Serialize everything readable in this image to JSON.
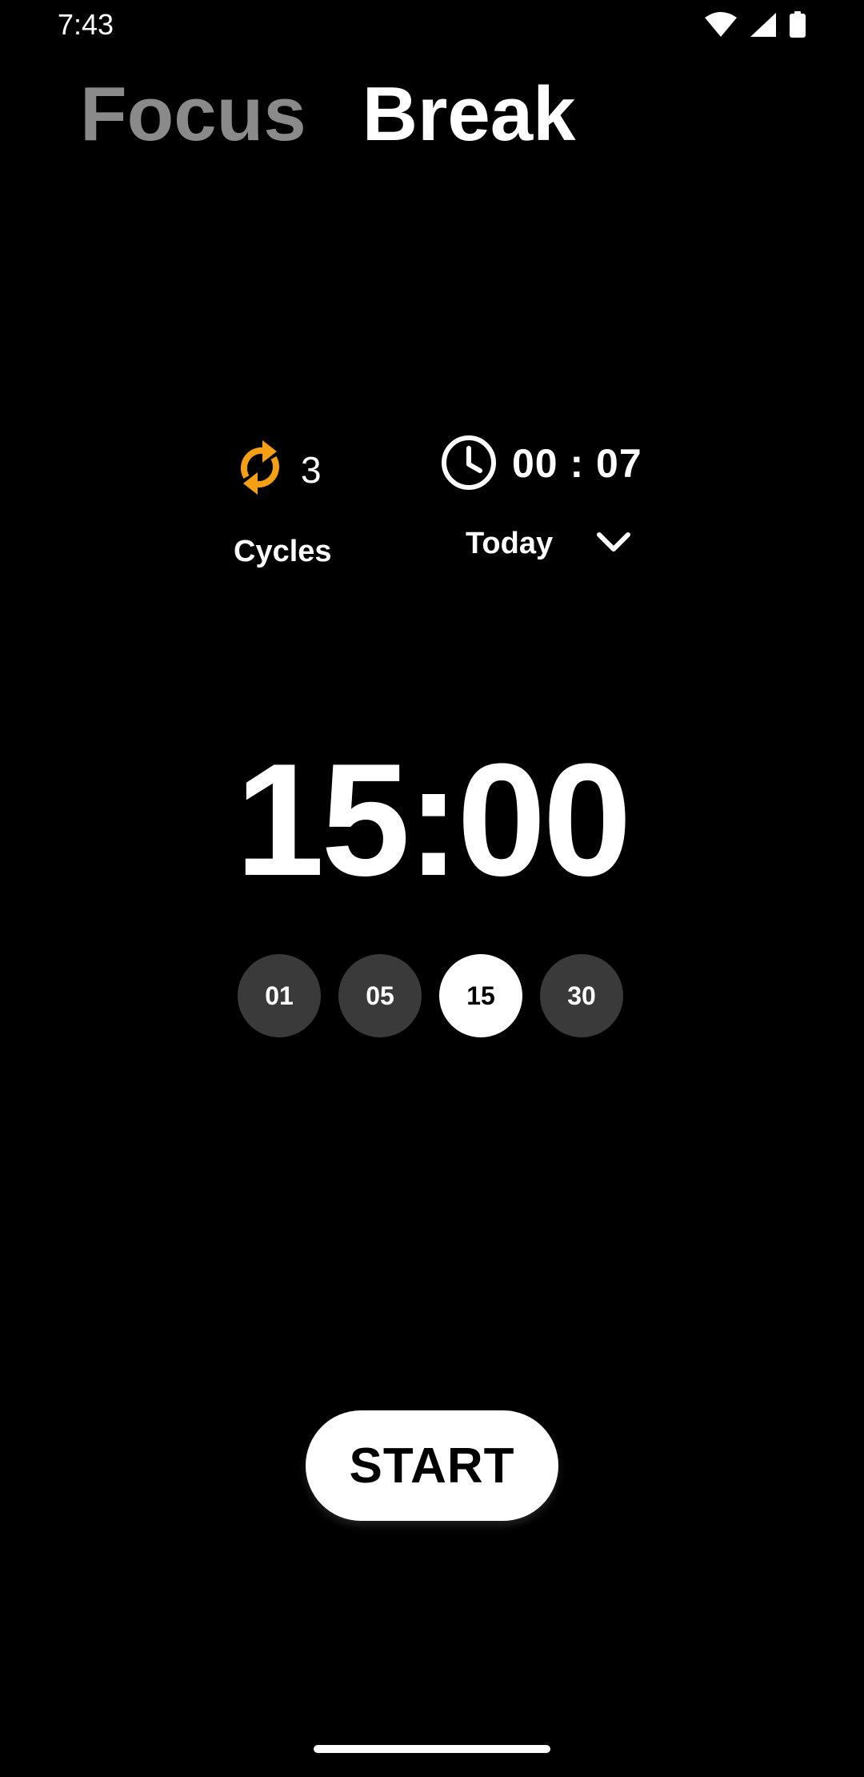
{
  "status_bar": {
    "time": "7:43",
    "icons": [
      "wifi-icon",
      "cell-signal-icon",
      "battery-icon"
    ]
  },
  "tabs": [
    {
      "label": "Focus",
      "active": false
    },
    {
      "label": "Break",
      "active": true
    }
  ],
  "stats": {
    "cycles_count": "3",
    "cycles_label": "Cycles",
    "total_time": "00 : 07",
    "period": "Today"
  },
  "timer": {
    "display": "15:00"
  },
  "presets": {
    "options": [
      "01",
      "05",
      "15",
      "30"
    ],
    "selected": "15"
  },
  "actions": {
    "start_label": "START"
  },
  "colors": {
    "background": "#000000",
    "accent_orange": "#F5A014",
    "inactive_tab": "#8A8A8A",
    "preset_bg": "#3A3A3A",
    "selected_preset_bg": "#FFFFFF"
  }
}
